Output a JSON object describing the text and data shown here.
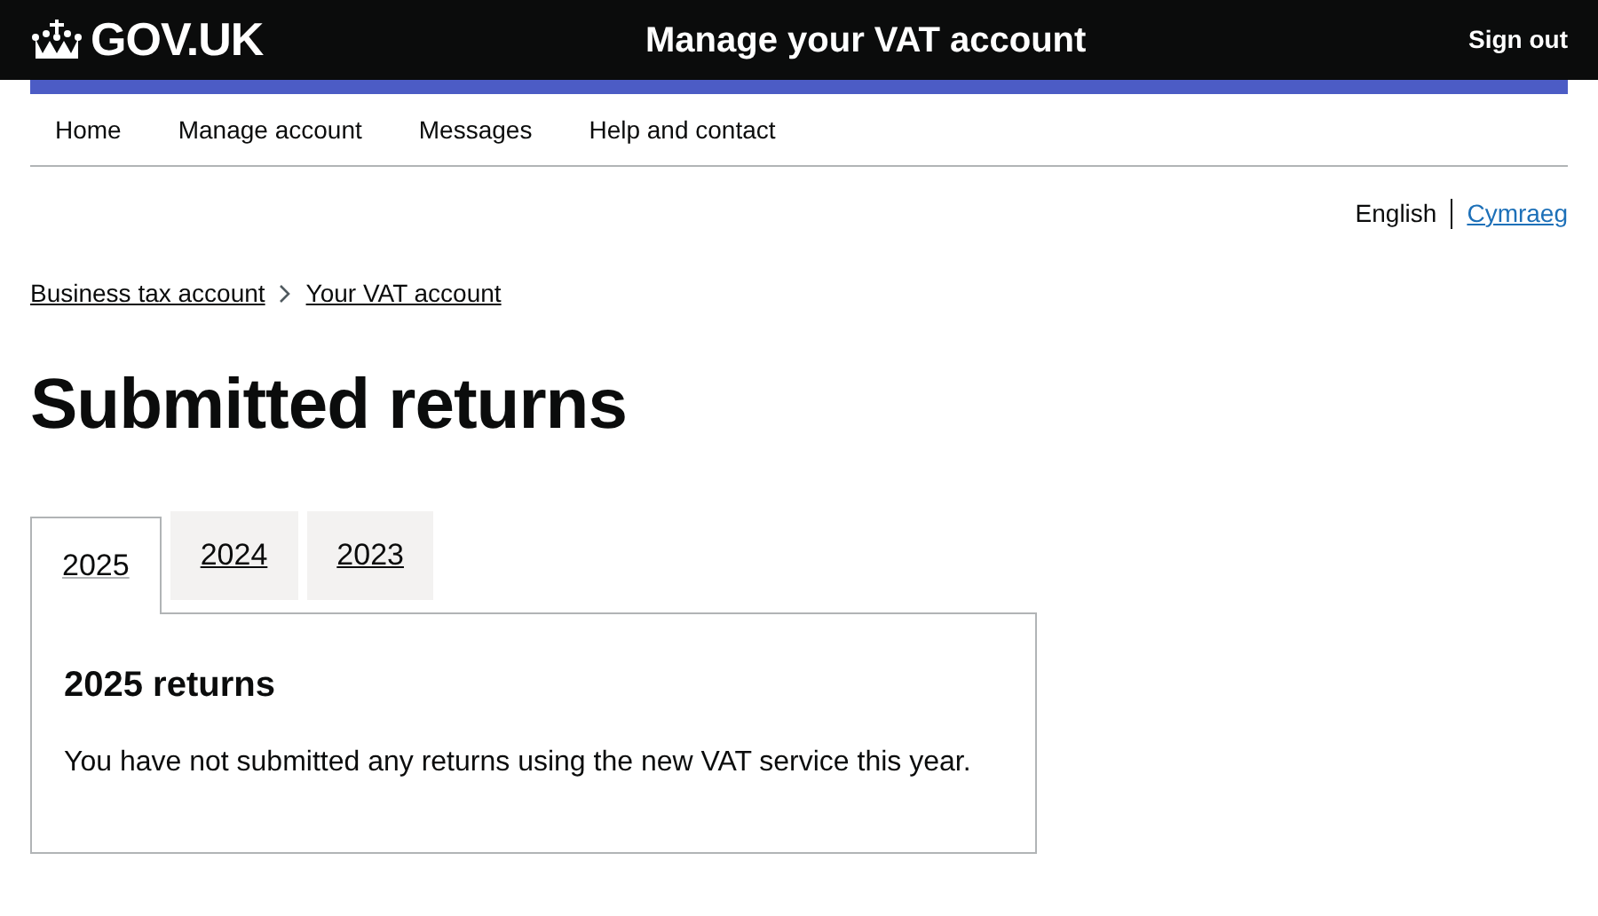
{
  "header": {
    "logo": "GOV.UK",
    "service_name": "Manage your VAT account",
    "sign_out": "Sign out"
  },
  "nav": [
    {
      "label": "Home"
    },
    {
      "label": "Manage account"
    },
    {
      "label": "Messages"
    },
    {
      "label": "Help and contact"
    }
  ],
  "language_toggle": [
    {
      "label": "English",
      "selected": true
    },
    {
      "label": "Cymraeg",
      "selected": false
    }
  ],
  "breadcrumbs": [
    {
      "label": "Business tax account"
    },
    {
      "label": "Your VAT account"
    }
  ],
  "title": "Submitted returns",
  "tabs": [
    {
      "label": "2025",
      "selected": true
    },
    {
      "label": "2024",
      "selected": false
    },
    {
      "label": "2023",
      "selected": false
    }
  ],
  "panel": {
    "heading": "2025 returns",
    "body": "You have not submitted any returns using the new VAT service this year."
  }
}
